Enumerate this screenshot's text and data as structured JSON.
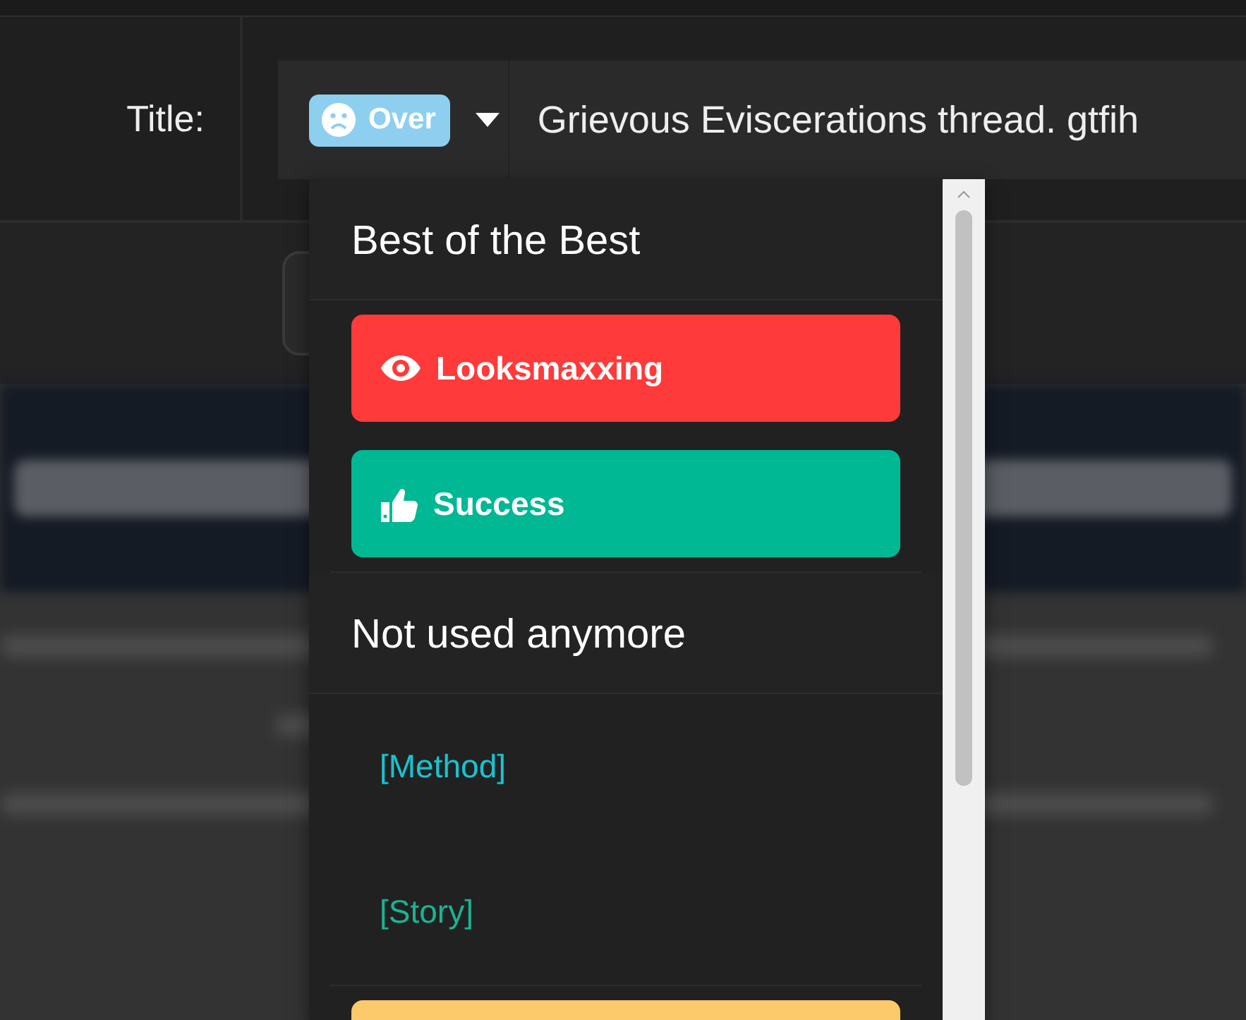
{
  "form": {
    "label": "Title:",
    "prefix": {
      "label": "Over",
      "color": "#8ecff0"
    },
    "value": "Grievous Eviscerations thread. gtfih"
  },
  "prefix_menu": {
    "groups": [
      {
        "title": "Best of the Best",
        "items": [
          {
            "kind": "badge",
            "label": "Looksmaxxing",
            "color": "#ff3a3a"
          },
          {
            "kind": "badge",
            "label": "Success",
            "color": "#00b894"
          }
        ]
      },
      {
        "title": "Not used anymore",
        "items": [
          {
            "kind": "text",
            "label": "[Method]",
            "color": "#19c3d0"
          },
          {
            "kind": "text",
            "label": "[Story]",
            "color": "#1ab394"
          }
        ]
      },
      {
        "items": [
          {
            "kind": "badge",
            "color": "#fcc96b"
          }
        ]
      }
    ]
  }
}
